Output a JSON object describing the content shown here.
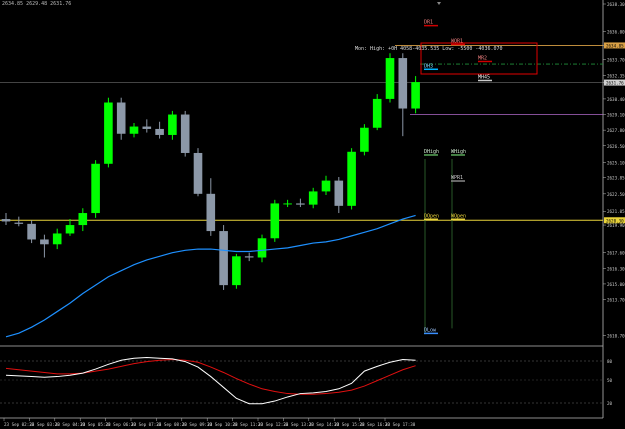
{
  "header": {
    "text": "2634.85 2629.48 2631.76"
  },
  "mon_label": "Mon: High: +0H 4058-4035.535 Low: -5500 -4036.070",
  "price_axis": {
    "ticks": [
      "2638.30",
      "2636.00",
      "2634.85",
      "2633.70",
      "2632.35",
      "2631.76",
      "2630.40",
      "2629.10",
      "2627.80",
      "2626.50",
      "2625.10",
      "2623.85",
      "2622.50",
      "2621.05",
      "2619.90",
      "2617.60",
      "2616.30",
      "2615.00",
      "2613.70",
      "2610.70"
    ],
    "current_price": "2631.76",
    "level_labels": {
      "wor1": "2634.85",
      "dopen": "2620.30"
    }
  },
  "time_axis": {
    "ticks": [
      "23 Sep 02:30",
      "23 Sep 03:30",
      "23 Sep 04:30",
      "23 Sep 05:30",
      "23 Sep 06:30",
      "23 Sep 07:30",
      "23 Sep 08:30",
      "23 Sep 09:30",
      "23 Sep 10:30",
      "23 Sep 11:30",
      "23 Sep 12:30",
      "23 Sep 13:30",
      "23 Sep 14:30",
      "23 Sep 15:30",
      "23 Sep 16:30",
      "23 Sep 17:30"
    ]
  },
  "indicator_axis": {
    "ticks": [
      "80",
      "50",
      "20"
    ]
  },
  "level_tags": {
    "dr1": "DR1",
    "wor1": "WOR1",
    "dh3": "DH3",
    "mr2": "MR2",
    "mh45": "MH45",
    "dhigh": "DHigh",
    "whigh": "WHigh",
    "wpr1": "WPR1",
    "dopen": "DOpen",
    "wopen": "WOpen",
    "dlow": "DLow"
  },
  "colors": {
    "bull": "#00ff00",
    "bear": "#8c98a8",
    "ma": "#1e90ff",
    "osc_fast": "#ffffff",
    "osc_slow": "#e01010",
    "level_orange": "#d9a045",
    "level_yellow": "#e8d23a",
    "box_red": "#e00000"
  },
  "chart_data": {
    "type": "candlestick",
    "price_range": [
      2610.0,
      2638.3
    ],
    "candles": [
      {
        "o": 2620.4,
        "h": 2620.9,
        "l": 2619.9,
        "c": 2620.2
      },
      {
        "o": 2620.1,
        "h": 2620.6,
        "l": 2619.8,
        "c": 2620.0
      },
      {
        "o": 2620.0,
        "h": 2620.3,
        "l": 2618.4,
        "c": 2618.7
      },
      {
        "o": 2618.7,
        "h": 2619.1,
        "l": 2617.2,
        "c": 2618.3
      },
      {
        "o": 2618.3,
        "h": 2619.6,
        "l": 2617.9,
        "c": 2619.2
      },
      {
        "o": 2619.2,
        "h": 2620.4,
        "l": 2619.0,
        "c": 2619.9
      },
      {
        "o": 2619.9,
        "h": 2621.3,
        "l": 2619.4,
        "c": 2620.9
      },
      {
        "o": 2620.9,
        "h": 2625.3,
        "l": 2620.5,
        "c": 2625.0
      },
      {
        "o": 2625.0,
        "h": 2630.5,
        "l": 2624.7,
        "c": 2630.1
      },
      {
        "o": 2630.1,
        "h": 2630.5,
        "l": 2627.0,
        "c": 2627.5
      },
      {
        "o": 2627.5,
        "h": 2628.4,
        "l": 2627.2,
        "c": 2628.1
      },
      {
        "o": 2628.1,
        "h": 2628.7,
        "l": 2627.6,
        "c": 2627.9
      },
      {
        "o": 2627.9,
        "h": 2628.5,
        "l": 2627.1,
        "c": 2627.4
      },
      {
        "o": 2627.4,
        "h": 2629.4,
        "l": 2627.0,
        "c": 2629.1
      },
      {
        "o": 2629.1,
        "h": 2629.4,
        "l": 2625.6,
        "c": 2625.9
      },
      {
        "o": 2625.9,
        "h": 2626.3,
        "l": 2622.3,
        "c": 2622.5
      },
      {
        "o": 2622.5,
        "h": 2623.8,
        "l": 2619.0,
        "c": 2619.4
      },
      {
        "o": 2619.4,
        "h": 2619.9,
        "l": 2614.5,
        "c": 2614.9
      },
      {
        "o": 2614.9,
        "h": 2617.5,
        "l": 2614.6,
        "c": 2617.3
      },
      {
        "o": 2617.3,
        "h": 2617.6,
        "l": 2616.9,
        "c": 2617.2
      },
      {
        "o": 2617.2,
        "h": 2619.1,
        "l": 2616.8,
        "c": 2618.8
      },
      {
        "o": 2618.8,
        "h": 2622.0,
        "l": 2618.5,
        "c": 2621.7
      },
      {
        "o": 2621.7,
        "h": 2622.0,
        "l": 2621.4,
        "c": 2621.7
      },
      {
        "o": 2621.7,
        "h": 2622.1,
        "l": 2621.4,
        "c": 2621.6
      },
      {
        "o": 2621.6,
        "h": 2623.0,
        "l": 2621.3,
        "c": 2622.7
      },
      {
        "o": 2622.7,
        "h": 2624.0,
        "l": 2622.4,
        "c": 2623.6
      },
      {
        "o": 2623.6,
        "h": 2623.9,
        "l": 2620.9,
        "c": 2621.5
      },
      {
        "o": 2621.5,
        "h": 2626.3,
        "l": 2621.2,
        "c": 2626.0
      },
      {
        "o": 2626.0,
        "h": 2628.3,
        "l": 2625.7,
        "c": 2628.0
      },
      {
        "o": 2628.0,
        "h": 2630.8,
        "l": 2627.8,
        "c": 2630.4
      },
      {
        "o": 2630.4,
        "h": 2634.2,
        "l": 2630.1,
        "c": 2633.8
      },
      {
        "o": 2633.8,
        "h": 2634.2,
        "l": 2627.3,
        "c": 2629.6
      },
      {
        "o": 2629.6,
        "h": 2632.3,
        "l": 2629.2,
        "c": 2631.8
      }
    ],
    "moving_average": [
      2610.6,
      2610.9,
      2611.4,
      2612.0,
      2612.7,
      2613.4,
      2614.2,
      2614.9,
      2615.6,
      2616.1,
      2616.6,
      2617.0,
      2617.3,
      2617.6,
      2617.8,
      2617.9,
      2617.9,
      2617.8,
      2617.7,
      2617.7,
      2617.8,
      2617.9,
      2618.0,
      2618.2,
      2618.4,
      2618.5,
      2618.7,
      2619.0,
      2619.3,
      2619.6,
      2620.0,
      2620.4,
      2620.7
    ],
    "levels": {
      "dr1": 2636.0,
      "wor1": 2634.85,
      "dh3": 2633.2,
      "mr2": 2633.6,
      "mh45": 2632.6,
      "dhigh": 2625.4,
      "whigh": 2625.4,
      "wpr1": 2623.9,
      "dopen": 2620.3,
      "wopen": 2620.3,
      "dlow": 2610.8,
      "orange_line": 2634.85,
      "green_dash": 2633.3,
      "grey_line": 2631.76,
      "purple_line": 2629.1
    },
    "oscillator": {
      "range": [
        0,
        100
      ],
      "fast": [
        60,
        59,
        58,
        57,
        58,
        60,
        63,
        69,
        76,
        82,
        85,
        86,
        85,
        84,
        80,
        72,
        58,
        42,
        26,
        18,
        18,
        22,
        28,
        33,
        34,
        36,
        40,
        48,
        66,
        73,
        79,
        83,
        82
      ],
      "slow": [
        70,
        68,
        66,
        64,
        62,
        62,
        63,
        66,
        69,
        73,
        77,
        80,
        82,
        83,
        82,
        79,
        72,
        64,
        55,
        47,
        40,
        36,
        33,
        32,
        32,
        33,
        35,
        38,
        44,
        52,
        60,
        68,
        74
      ]
    }
  }
}
